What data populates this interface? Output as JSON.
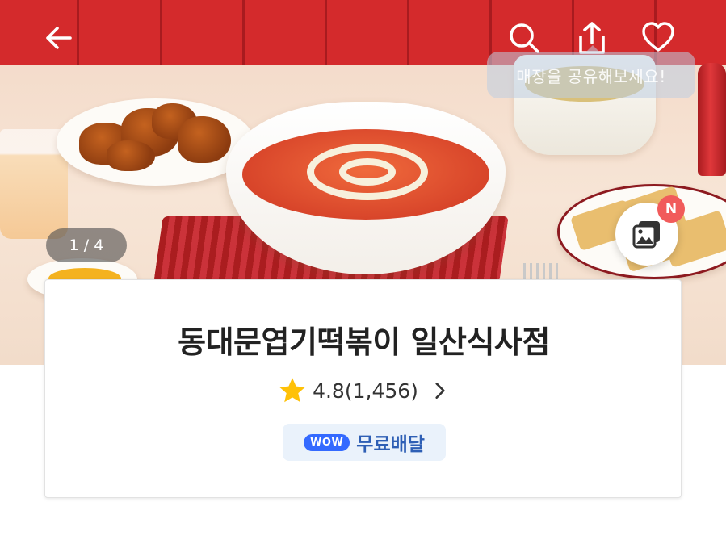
{
  "topbar": {
    "back_icon": "arrow-left-icon",
    "search_icon": "search-icon",
    "share_icon": "share-icon",
    "favorite_icon": "heart-icon",
    "icon_color": "#ffffff"
  },
  "share_tooltip": "매장을 공유해보세요!",
  "hero": {
    "image_counter": "1 / 4",
    "gallery_icon": "photo-gallery-icon",
    "new_badge": "N"
  },
  "store": {
    "name": "동대문엽기떡볶이 일산식사점",
    "rating": "4.8",
    "review_count": "(1,456)",
    "rating_display": "4.8(1,456)",
    "star_color": "#ffc107",
    "delivery_badge": {
      "wow_label": "WOW",
      "label": "무료배달",
      "accent": "#346aff"
    }
  }
}
